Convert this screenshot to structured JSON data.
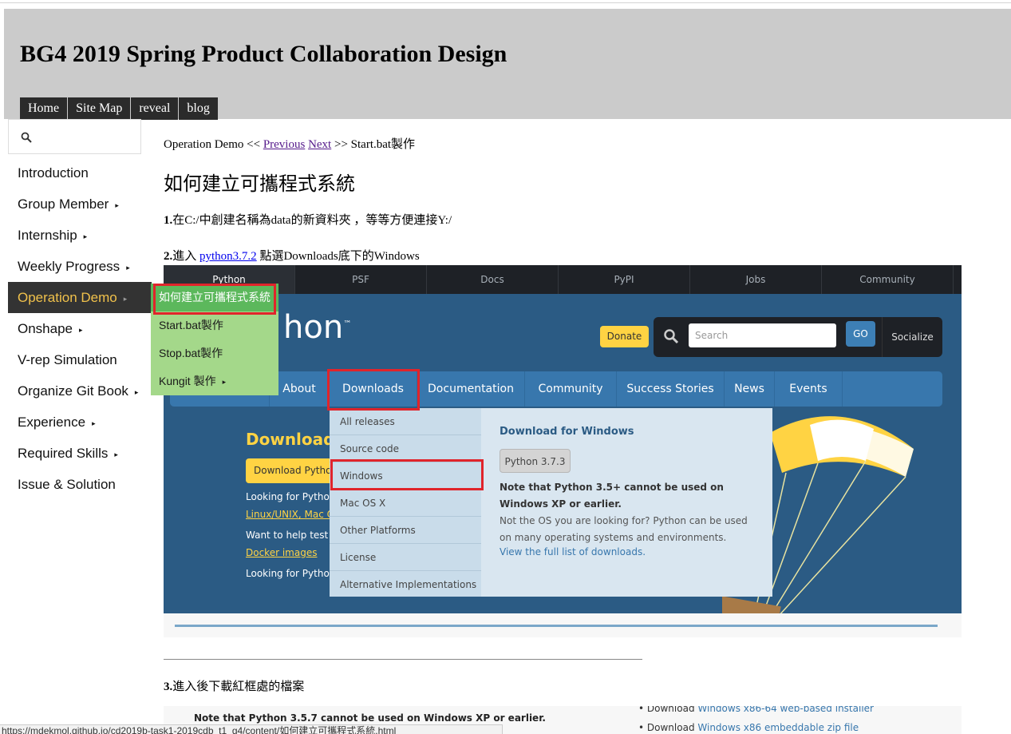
{
  "site": {
    "title": "BG4 2019 Spring Product Collaboration Design",
    "nav": [
      "Home",
      "Site Map",
      "reveal",
      "blog"
    ]
  },
  "sidebar": {
    "search_icon": "search-icon",
    "items": [
      {
        "label": "Introduction",
        "has_arrow": false
      },
      {
        "label": "Group Member",
        "has_arrow": true
      },
      {
        "label": "Internship",
        "has_arrow": true
      },
      {
        "label": "Weekly Progress",
        "has_arrow": true
      },
      {
        "label": "Operation Demo",
        "has_arrow": true,
        "active": true
      },
      {
        "label": "Onshape",
        "has_arrow": true
      },
      {
        "label": "V-rep Simulation",
        "has_arrow": false
      },
      {
        "label": "Organize Git Book",
        "has_arrow": true
      },
      {
        "label": "Experience",
        "has_arrow": true
      },
      {
        "label": "Required Skills",
        "has_arrow": true
      },
      {
        "label": "Issue & Solution",
        "has_arrow": false
      }
    ],
    "arrow_glyph": "▸",
    "submenu": [
      {
        "label": "如何建立可攜程式系統",
        "highlight": true
      },
      {
        "label": "Start.bat製作"
      },
      {
        "label": "Stop.bat製作"
      },
      {
        "label": "Kungit 製作",
        "has_arrow": true
      }
    ]
  },
  "content": {
    "breadcrumb": {
      "prefix": "Operation Demo <<",
      "previous": "Previous",
      "next": "Next",
      "suffix": ">> Start.bat製作"
    },
    "heading": "如何建立可攜程式系統",
    "step1": {
      "num": "1.",
      "text": "在C:/中創建名稱為data的新資料夾 ，等等方便連接Y:/"
    },
    "step2": {
      "num": "2.",
      "pre": "進入",
      "link": "python3.7.2",
      "post": "點選Downloads底下的Windows"
    },
    "step3": {
      "num": "3.",
      "text": "進入後下載紅框處的檔案"
    }
  },
  "python_screenshot": {
    "tabs": [
      "Python",
      "PSF",
      "Docs",
      "PyPI",
      "Jobs",
      "Community"
    ],
    "logo_text": "hon",
    "logo_tm": "™",
    "donate": "Donate",
    "search_placeholder": "Search",
    "go": "GO",
    "socialize": "Socialize",
    "main_nav": [
      "About",
      "Downloads",
      "Documentation",
      "Community",
      "Success Stories",
      "News",
      "Events"
    ],
    "hero": {
      "title": "Download",
      "button": "Download Python",
      "line1": "Looking for Python",
      "line2": "Linux/UNIX, Mac OS",
      "line3": "Want to help test d",
      "line4": "Docker images",
      "line5": "Looking for Python"
    },
    "dropdown": [
      "All releases",
      "Source code",
      "Windows",
      "Mac OS X",
      "Other Platforms",
      "License",
      "Alternative Implementations"
    ],
    "panel": {
      "heading": "Download for Windows",
      "version": "Python 3.7.3",
      "note": "Note that Python 3.5+ cannot be used on Windows XP or earlier.",
      "body": "Not the OS you are looking for? Python can be used on many operating systems and environments.",
      "link": "View the full list of downloads."
    },
    "colors": {
      "navy": "#2b5b84",
      "yellow": "#ffd343",
      "nav_blue": "#3877ad",
      "red_highlight": "#e0242b"
    }
  },
  "python_screenshot2": {
    "note": "Note that Python 3.5.7 cannot be used on Windows XP or earlier.",
    "items": [
      {
        "pre": "Download",
        "link": "Windows x86-64 web-based installer"
      },
      {
        "pre": "Download",
        "link": "Windows x86 embeddable zip file"
      }
    ]
  },
  "status_url": "https://mdekmol.github.io/cd2019b-task1-2019cdb_t1_g4/content/如何建立可攜程式系統.html"
}
